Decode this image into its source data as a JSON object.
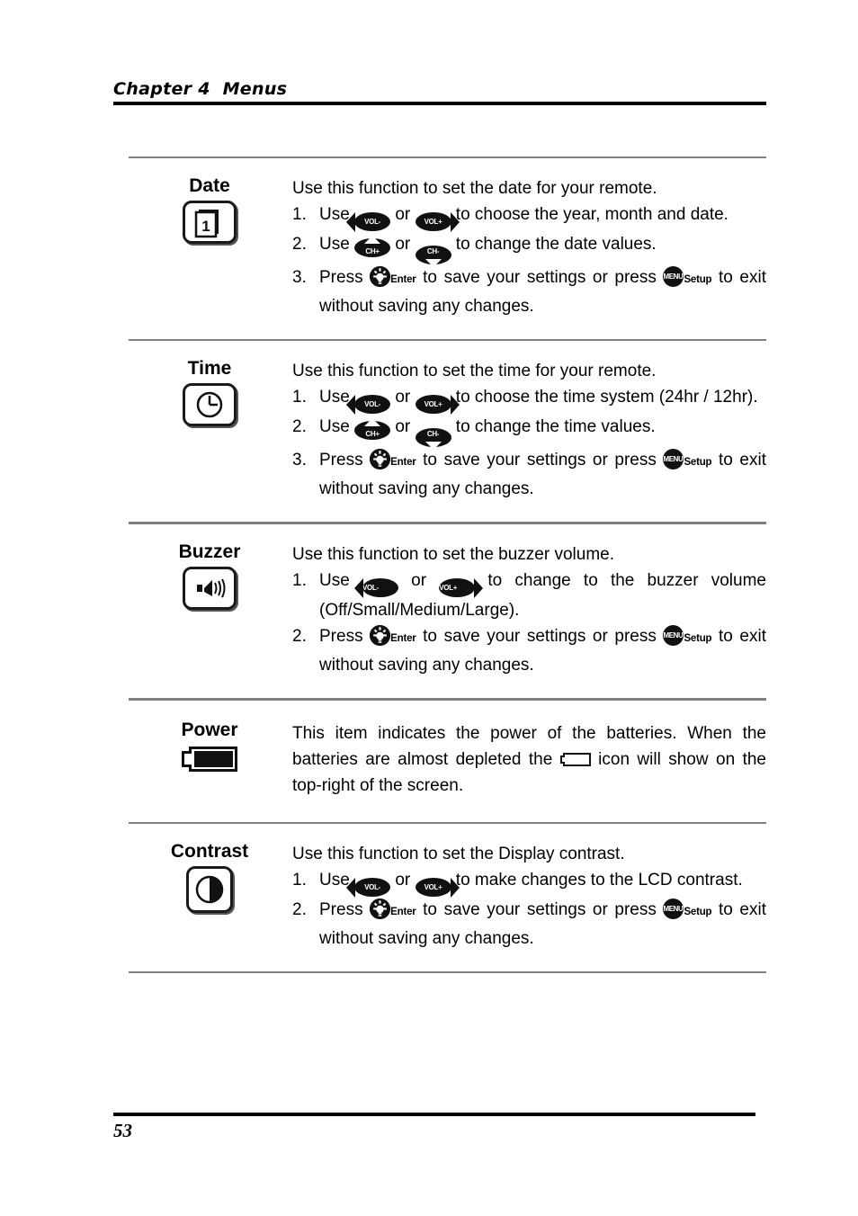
{
  "header": {
    "title": "Chapter 4  Menus"
  },
  "footer": {
    "page_number": "53"
  },
  "keys": {
    "vol_minus": "VOL-",
    "vol_plus": "VOL+",
    "ch_plus": "CH+",
    "ch_minus": "CH-",
    "menu": "MENU",
    "enter_caption": "Enter",
    "setup_caption": "Setup"
  },
  "sections": [
    {
      "id": "date",
      "label": "Date",
      "icon": "calendar-icon",
      "intro": "Use this function to set the date for your remote.",
      "steps": [
        {
          "parts": [
            "Use ",
            "[VOL-]",
            " or ",
            "[VOL+]",
            " to choose the year, month and date."
          ],
          "justify": false
        },
        {
          "parts": [
            "Use ",
            "[CH+]",
            " or ",
            "[CH-]",
            " to change the date values."
          ],
          "justify": false
        },
        {
          "parts": [
            "Press ",
            "[ENTER]",
            "Enter",
            " to save your settings or press ",
            "[MENU]",
            "Setup",
            " to exit without saving any changes."
          ],
          "justify": true
        }
      ]
    },
    {
      "id": "time",
      "label": "Time",
      "icon": "clock-icon",
      "intro": "Use this function to set the time for your remote.",
      "steps": [
        {
          "parts": [
            "Use ",
            "[VOL-]",
            " or ",
            "[VOL+]",
            " to choose the time system (24hr / 12hr)."
          ],
          "justify": false
        },
        {
          "parts": [
            "Use ",
            "[CH+]",
            " or ",
            "[CH-]",
            " to change the time values."
          ],
          "justify": false
        },
        {
          "parts": [
            "Press ",
            "[ENTER]",
            "Enter",
            " to save your settings or press ",
            "[MENU]",
            "Setup",
            " to exit without saving any changes."
          ],
          "justify": true
        }
      ]
    },
    {
      "id": "buzzer",
      "label": "Buzzer",
      "icon": "speaker-icon",
      "intro": "Use this function to set the buzzer volume.",
      "steps": [
        {
          "parts": [
            "Use ",
            "[VOL-]",
            " or ",
            "[VOL+]",
            " to change to the buzzer volume (Off/Small/Medium/Large)."
          ],
          "justify": true
        },
        {
          "parts": [
            "Press ",
            "[ENTER]",
            "Enter",
            " to save your settings or press ",
            "[MENU]",
            "Setup",
            " to exit without saving any changes."
          ],
          "justify": true
        }
      ]
    },
    {
      "id": "power",
      "label": "Power",
      "icon": "battery-full-icon",
      "paragraph_1": "This item indicates the power of the batteries. When the batteries are almost depleted the ",
      "paragraph_2": " icon will show on the top-right of the screen.",
      "inline_icon": "battery-empty-icon"
    },
    {
      "id": "contrast",
      "label": "Contrast",
      "icon": "contrast-icon",
      "intro": "Use this function to set the Display contrast.",
      "steps": [
        {
          "parts": [
            "Use ",
            "[VOL-]",
            " or ",
            "[VOL+]",
            " to make changes to the LCD contrast."
          ],
          "justify": false
        },
        {
          "parts": [
            "Press ",
            "[ENTER]",
            "Enter",
            " to save your settings or press ",
            "[MENU]",
            "Setup",
            " to exit without saving any changes."
          ],
          "justify": true
        }
      ]
    }
  ],
  "text_fragments": {
    "use": "Use ",
    "or": " or ",
    "or_wide": " or ",
    "press": "Press ",
    "to_save": " to save your settings or press ",
    "to_exit": " to exit without saving any changes.",
    "date_s1_tail": " to choose the year, month and date.",
    "date_s2_tail": " to change the date values.",
    "time_s1_tail": " to choose the time system (24hr / 12hr).",
    "time_s2_tail": " to change the time values.",
    "buzzer_s1_tail": " to change to the buzzer volume (Off/Small/Medium/Large).",
    "contrast_s1_tail": " to make changes to the LCD contrast."
  },
  "colors": {
    "rule_black": "#000000",
    "separator_gray": "#808080",
    "icon_black": "#111111",
    "page_background": "#ffffff"
  }
}
